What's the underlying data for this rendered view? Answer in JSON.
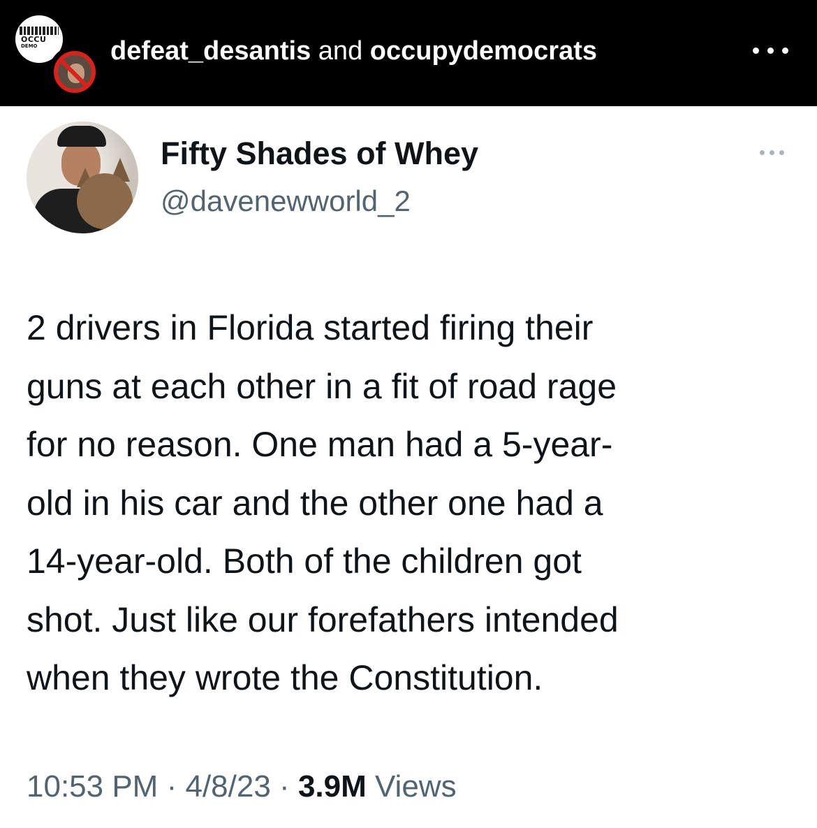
{
  "ig_header": {
    "user1": "defeat_desantis",
    "conjunction": "and",
    "user2": "occupydemocrats",
    "avatar_text_top": "OCCU",
    "avatar_text_bottom": "DEMO"
  },
  "tweet": {
    "display_name": "Fifty Shades of Whey",
    "handle": "@davenewworld_2",
    "body_lines": [
      "2 drivers in Florida started firing their",
      "guns at each other in a fit of road rage",
      "for no reason. One man had a 5-year-",
      "old in his car and the other one had a",
      "14-year-old. Both of the children got",
      "shot. Just like our forefathers intended",
      "when they wrote the Constitution."
    ],
    "time": "10:53 PM",
    "separator": "·",
    "date": "4/8/23",
    "views_count": "3.9M",
    "views_label": "Views"
  },
  "colors": {
    "header_bg": "#000000",
    "text_primary": "#0f1419",
    "text_secondary": "#536471",
    "ring_red": "#d8221c"
  },
  "icons": {
    "header_menu": "more-horizontal-icon",
    "tweet_menu": "more-horizontal-icon"
  }
}
